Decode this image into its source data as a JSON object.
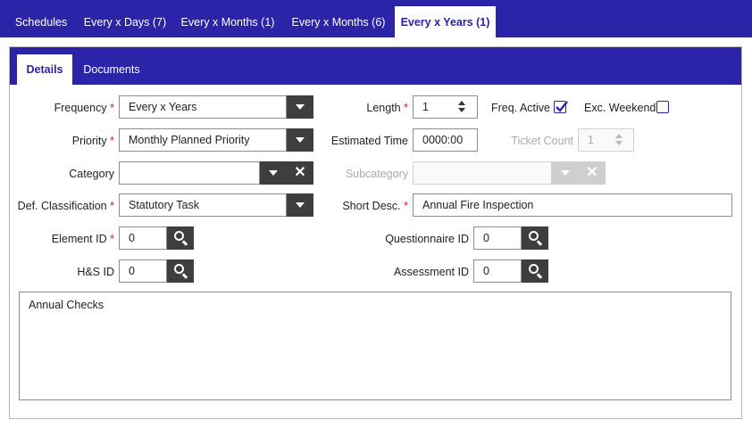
{
  "top_tabs": [
    {
      "label": "Schedules"
    },
    {
      "label": "Every x Days (7)"
    },
    {
      "label": "Every x Months (1)"
    },
    {
      "label": "Every x Months (6)"
    },
    {
      "label": "Every x Years (1)"
    }
  ],
  "sub_tabs": [
    {
      "label": "Details"
    },
    {
      "label": "Documents"
    }
  ],
  "required_mark": "*",
  "form": {
    "frequency": {
      "label": "Frequency",
      "value": "Every x Years"
    },
    "priority": {
      "label": "Priority",
      "value": "Monthly Planned Priority"
    },
    "category": {
      "label": "Category",
      "value": ""
    },
    "def_classification": {
      "label": "Def. Classification",
      "value": "Statutory Task"
    },
    "element_id": {
      "label": "Element ID",
      "value": "0"
    },
    "hs_id": {
      "label": "H&S ID",
      "value": "0"
    },
    "length": {
      "label": "Length",
      "value": "1"
    },
    "freq_active": {
      "label": "Freq. Active",
      "checked": true
    },
    "exc_weekend": {
      "label": "Exc. Weekend",
      "checked": false
    },
    "estimated_time": {
      "label": "Estimated Time",
      "value": "0000:00"
    },
    "ticket_count": {
      "label": "Ticket Count",
      "value": "1"
    },
    "subcategory": {
      "label": "Subcategory",
      "value": ""
    },
    "short_desc": {
      "label": "Short Desc.",
      "value": "Annual Fire Inspection"
    },
    "questionnaire_id": {
      "label": "Questionnaire ID",
      "value": "0"
    },
    "assessment_id": {
      "label": "Assessment ID",
      "value": "0"
    },
    "notes": "Annual Checks"
  },
  "icons": {
    "dropdown": "chevron-down-icon",
    "clear": "close-icon",
    "search": "search-icon",
    "spinner": "spinner-arrows-icon",
    "check": "checkmark-icon"
  },
  "colors": {
    "brand": "#2b23a8",
    "button_dark": "#3e3e3e",
    "required": "#d01f1f"
  }
}
